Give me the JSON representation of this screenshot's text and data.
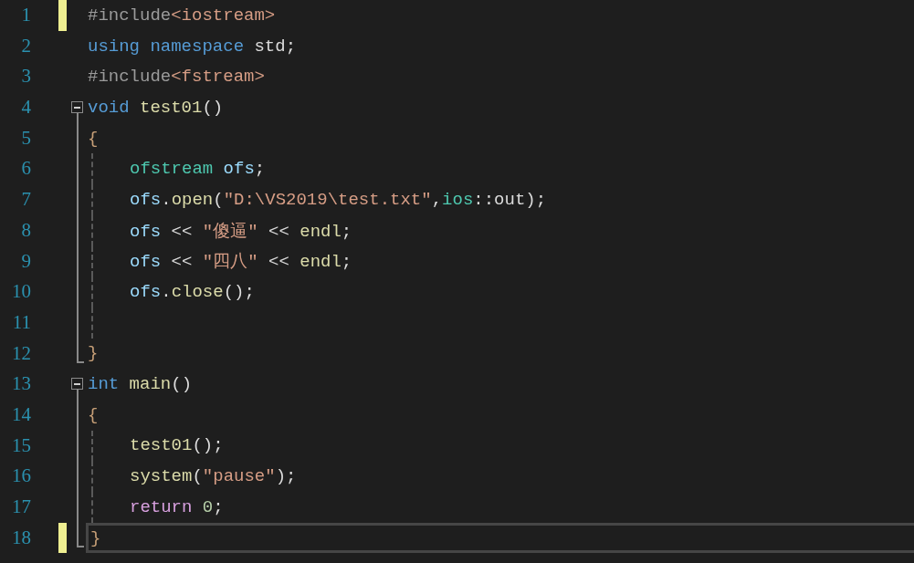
{
  "editor": {
    "lines": [
      {
        "number": "1",
        "modified": true,
        "current": false,
        "fold_start": false,
        "fold_end": false,
        "guide": false,
        "tokens": [
          {
            "kind": "preproc",
            "text": "#include"
          },
          {
            "kind": "string",
            "text": "<iostream>"
          }
        ]
      },
      {
        "number": "2",
        "modified": false,
        "current": false,
        "fold_start": false,
        "fold_end": false,
        "guide": false,
        "tokens": [
          {
            "kind": "keyword",
            "text": "using namespace"
          },
          {
            "kind": "plain",
            "text": " std;"
          }
        ]
      },
      {
        "number": "3",
        "modified": false,
        "current": false,
        "fold_start": false,
        "fold_end": false,
        "guide": false,
        "tokens": [
          {
            "kind": "preproc",
            "text": "#include"
          },
          {
            "kind": "string",
            "text": "<fstream>"
          }
        ]
      },
      {
        "number": "4",
        "modified": false,
        "current": false,
        "fold_start": true,
        "fold_end": false,
        "guide": false,
        "tokens": [
          {
            "kind": "keyword",
            "text": "void"
          },
          {
            "kind": "function",
            "text": " test01"
          },
          {
            "kind": "plain",
            "text": "()"
          }
        ]
      },
      {
        "number": "5",
        "modified": false,
        "current": false,
        "fold_start": false,
        "fold_end": false,
        "guide": false,
        "tokens": [
          {
            "kind": "brace",
            "text": "{"
          }
        ]
      },
      {
        "number": "6",
        "modified": false,
        "current": false,
        "fold_start": false,
        "fold_end": false,
        "guide": true,
        "tokens": [
          {
            "kind": "type",
            "text": "ofstream"
          },
          {
            "kind": "variable",
            "text": " ofs"
          },
          {
            "kind": "plain",
            "text": ";"
          }
        ]
      },
      {
        "number": "7",
        "modified": false,
        "current": false,
        "fold_start": false,
        "fold_end": false,
        "guide": true,
        "tokens": [
          {
            "kind": "variable",
            "text": "ofs"
          },
          {
            "kind": "plain",
            "text": "."
          },
          {
            "kind": "function",
            "text": "open"
          },
          {
            "kind": "plain",
            "text": "("
          },
          {
            "kind": "string",
            "text": "\"D:\\VS2019\\test.txt\""
          },
          {
            "kind": "plain",
            "text": ","
          },
          {
            "kind": "type",
            "text": "ios"
          },
          {
            "kind": "plain",
            "text": "::out);"
          }
        ]
      },
      {
        "number": "8",
        "modified": false,
        "current": false,
        "fold_start": false,
        "fold_end": false,
        "guide": true,
        "tokens": [
          {
            "kind": "variable",
            "text": "ofs"
          },
          {
            "kind": "plain",
            "text": " << "
          },
          {
            "kind": "string",
            "text": "\"傻逼\""
          },
          {
            "kind": "plain",
            "text": " << "
          },
          {
            "kind": "function",
            "text": "endl"
          },
          {
            "kind": "plain",
            "text": ";"
          }
        ]
      },
      {
        "number": "9",
        "modified": false,
        "current": false,
        "fold_start": false,
        "fold_end": false,
        "guide": true,
        "tokens": [
          {
            "kind": "variable",
            "text": "ofs"
          },
          {
            "kind": "plain",
            "text": " << "
          },
          {
            "kind": "string",
            "text": "\"四八\""
          },
          {
            "kind": "plain",
            "text": " << "
          },
          {
            "kind": "function",
            "text": "endl"
          },
          {
            "kind": "plain",
            "text": ";"
          }
        ]
      },
      {
        "number": "10",
        "modified": false,
        "current": false,
        "fold_start": false,
        "fold_end": false,
        "guide": true,
        "tokens": [
          {
            "kind": "variable",
            "text": "ofs"
          },
          {
            "kind": "plain",
            "text": "."
          },
          {
            "kind": "function",
            "text": "close"
          },
          {
            "kind": "plain",
            "text": "();"
          }
        ]
      },
      {
        "number": "11",
        "modified": false,
        "current": false,
        "fold_start": false,
        "fold_end": false,
        "guide": true
      },
      {
        "number": "12",
        "modified": false,
        "current": false,
        "fold_start": false,
        "fold_end": true,
        "guide": false,
        "tokens": [
          {
            "kind": "brace",
            "text": "}"
          }
        ]
      },
      {
        "number": "13",
        "modified": false,
        "current": false,
        "fold_start": true,
        "fold_end": false,
        "guide": false,
        "tokens": [
          {
            "kind": "keyword",
            "text": "int"
          },
          {
            "kind": "function",
            "text": " main"
          },
          {
            "kind": "plain",
            "text": "()"
          }
        ]
      },
      {
        "number": "14",
        "modified": false,
        "current": false,
        "fold_start": false,
        "fold_end": false,
        "guide": false,
        "tokens": [
          {
            "kind": "brace",
            "text": "{"
          }
        ]
      },
      {
        "number": "15",
        "modified": false,
        "current": false,
        "fold_start": false,
        "fold_end": false,
        "guide": true,
        "tokens": [
          {
            "kind": "function",
            "text": "test01"
          },
          {
            "kind": "plain",
            "text": "();"
          }
        ]
      },
      {
        "number": "16",
        "modified": false,
        "current": false,
        "fold_start": false,
        "fold_end": false,
        "guide": true,
        "tokens": [
          {
            "kind": "function",
            "text": "system"
          },
          {
            "kind": "plain",
            "text": "("
          },
          {
            "kind": "string",
            "text": "\"pause\""
          },
          {
            "kind": "plain",
            "text": ");"
          }
        ]
      },
      {
        "number": "17",
        "modified": false,
        "current": false,
        "fold_start": false,
        "fold_end": false,
        "guide": true,
        "tokens": [
          {
            "kind": "control",
            "text": "return"
          },
          {
            "kind": "number",
            "text": " 0"
          },
          {
            "kind": "plain",
            "text": ";"
          }
        ]
      },
      {
        "number": "18",
        "modified": true,
        "current": true,
        "fold_start": false,
        "fold_end": true,
        "guide": false,
        "tokens": [
          {
            "kind": "brace",
            "text": "}"
          }
        ]
      }
    ]
  }
}
